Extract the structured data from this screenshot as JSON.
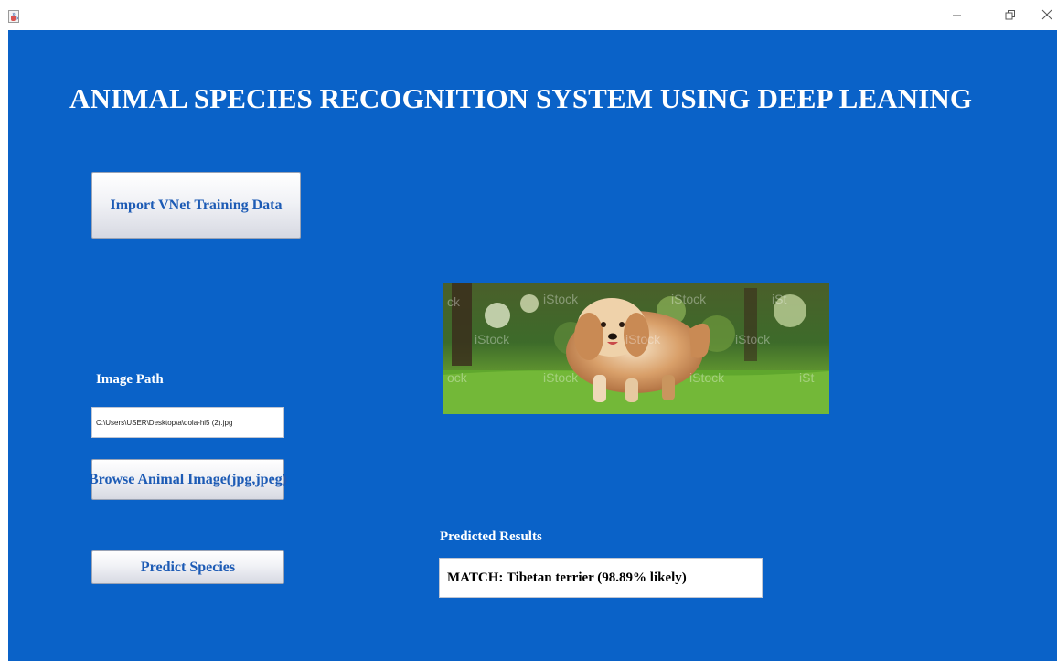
{
  "window": {
    "icon": "java-coffee-icon",
    "controls": {
      "minimize": "minimize-icon",
      "restore": "restore-icon",
      "close": "close-icon"
    }
  },
  "app": {
    "title": "ANIMAL SPECIES RECOGNITION SYSTEM USING DEEP LEANING",
    "import_button": "Import VNet Training Data",
    "image_path_label": "Image Path",
    "image_path_value": "C:\\Users\\USER\\Desktop\\a\\dola-hi5 (2).jpg",
    "browse_button": "Browse Animal Image(jpg,jpeg)",
    "predict_button": "Predict Species",
    "results_label": "Predicted Results",
    "result_value": "MATCH: Tibetan terrier (98.89% likely)",
    "preview_image": {
      "subject": "Tibetan terrier dog on grass",
      "watermark": "iStock"
    }
  },
  "colors": {
    "background": "#0a62c8",
    "title_text": "#ffffff",
    "button_text": "#1d5bb5",
    "titlebar": "#ffffff"
  }
}
